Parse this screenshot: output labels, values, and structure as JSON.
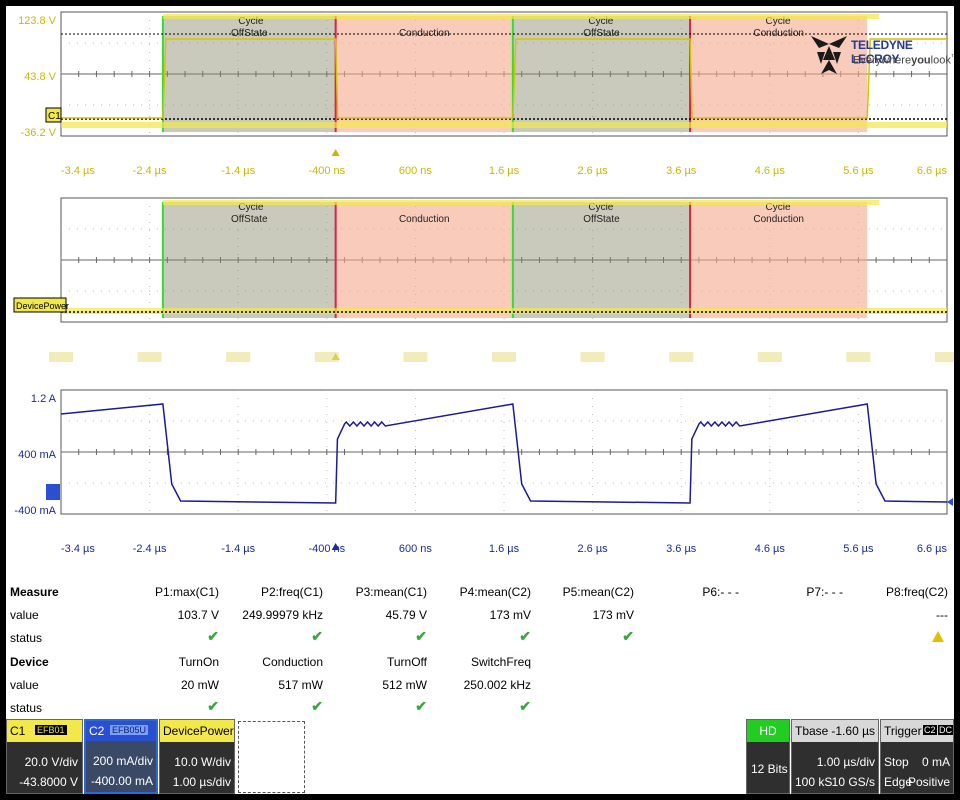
{
  "brand": {
    "name": "TELEDYNE LECROY",
    "tagline_pre": "Everywhere",
    "tagline_bold": "you",
    "tagline_post": "look"
  },
  "time_axis": [
    "-3.4 µs",
    "-2.4 µs",
    "-1.4 µs",
    "-400 ns",
    "600 ns",
    "1.6 µs",
    "2.6 µs",
    "3.6 µs",
    "4.6 µs",
    "5.6 µs",
    "6.6 µs"
  ],
  "panel1": {
    "y_labels": [
      "123.8 V",
      "43.8 V",
      "-36.2 V"
    ],
    "badge": "C1",
    "regions": [
      {
        "kind": "OffState",
        "label": "OffState",
        "tag": "Cycle",
        "x0": -2.25,
        "x1": -0.3
      },
      {
        "kind": "Conduction",
        "label": "Conduction",
        "tag": "",
        "x0": -0.3,
        "x1": 1.7
      },
      {
        "kind": "OffState",
        "label": "OffState",
        "tag": "Cycle",
        "x0": 1.7,
        "x1": 3.7
      },
      {
        "kind": "Conduction",
        "label": "Conduction",
        "tag": "Cycle",
        "x0": 3.7,
        "x1": 5.7
      }
    ]
  },
  "panel2": {
    "y_labels": [
      "",
      "",
      ""
    ],
    "badge": "DevicePower",
    "regions": [
      {
        "kind": "OffState",
        "label": "OffState",
        "tag": "Cycle",
        "x0": -2.25,
        "x1": -0.3
      },
      {
        "kind": "Conduction",
        "label": "Conduction",
        "tag": "",
        "x0": -0.3,
        "x1": 1.7
      },
      {
        "kind": "OffState",
        "label": "OffState",
        "tag": "Cycle",
        "x0": 1.7,
        "x1": 3.7
      },
      {
        "kind": "Conduction",
        "label": "Conduction",
        "tag": "Cycle",
        "x0": 3.7,
        "x1": 5.7
      }
    ]
  },
  "panel3": {
    "y_labels": [
      "1.2 A",
      "400 mA",
      "-400 mA"
    ]
  },
  "measure": {
    "title": "Measure",
    "headers": [
      "P1:max(C1)",
      "P2:freq(C1)",
      "P3:mean(C1)",
      "P4:mean(C2)",
      "P5:mean(C2)",
      "P6:- - -",
      "P7:- - -",
      "P8:freq(C2)"
    ],
    "value_label": "value",
    "status_label": "status",
    "values": [
      "103.7 V",
      "249.99979 kHz",
      "45.79 V",
      "173 mV",
      "173 mV",
      "",
      "",
      "---"
    ]
  },
  "device": {
    "title": "Device",
    "value_label": "value",
    "status_label": "status",
    "headers": [
      "TurnOn",
      "Conduction",
      "TurnOff",
      "SwitchFreq"
    ],
    "values": [
      "20 mW",
      "517 mW",
      "512 mW",
      "250.002 kHz"
    ]
  },
  "channels": {
    "c1": {
      "name": "C1",
      "tag": "EFB01",
      "vdiv": "20.0 V/div",
      "offset": "-43.8000 V",
      "color": "#f2e84a"
    },
    "c2": {
      "name": "C2",
      "tag": "EFB05U",
      "vdiv": "200 mA/div",
      "offset": "-400.00 mA",
      "color": "#2a4fd0"
    },
    "dp": {
      "name": "DevicePower",
      "vdiv": "10.0 W/div",
      "offset": "1.00 µs/div",
      "color": "#f2e84a"
    }
  },
  "acq": {
    "hd": "HD",
    "bits": "12 Bits"
  },
  "tbase": {
    "label": "Tbase",
    "delay": "-1.60 µs",
    "tdiv": "1.00 µs/div",
    "samples": "100 kS",
    "rate": "10 GS/s"
  },
  "trigger": {
    "label": "Trigger",
    "ch": "C2",
    "cpl": "DC",
    "mode": "Stop",
    "level": "0 mA",
    "type": "Edge",
    "slope": "Positive"
  }
}
